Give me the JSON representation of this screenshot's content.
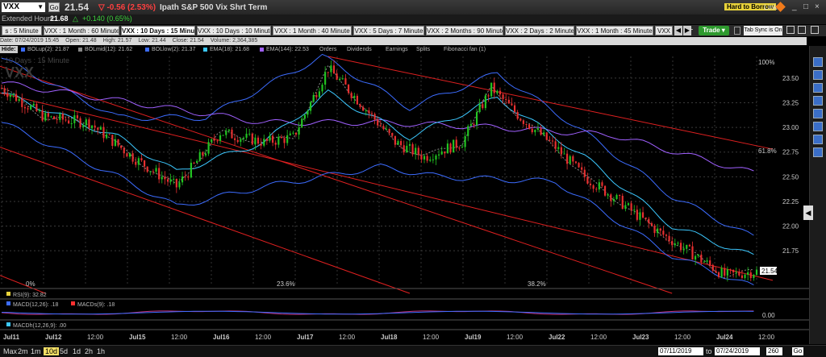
{
  "header": {
    "symbol": "VXX",
    "go_label": "Go",
    "last_price": "21.54",
    "change": "-0.56 (2.53%)",
    "name": "Ipath S&P 500 Vix Shrt Term",
    "hard_to_borrow": "Hard to Borrow",
    "link_label": "Link",
    "extended_label": "Extended Hours:",
    "extended_price": "21.68",
    "extended_change": "+0.140 (0.65%)"
  },
  "tabs": [
    "s : 5 Minute",
    "VXX : 1 Month : 60 Minute",
    "VXX : 10 Days : 15 Minute",
    "VXX : 10 Days : 10 Minute",
    "VXX : 1 Month : 40 Minute",
    "VXX : 5 Days : 7 Minute",
    "VXX : 2 Months : 90 Minute",
    "VXX : 2 Days : 2 Minute",
    "VXX : 1 Month : 45 Minute",
    "VXX"
  ],
  "trade_label": "Trade",
  "tab_sync_label": "Tab Sync is On",
  "info": {
    "date": "Date: 07/24/2019 15:45",
    "open": "Open: 21.48",
    "high": "High: 21.57",
    "low": "Low: 21.44",
    "close": "Close: 21.54",
    "volume": "Volume: 2,364,385"
  },
  "hide_label": "Hide:",
  "studies": [
    {
      "label": "BOLup(2): 21.87",
      "color": "#3c6cff"
    },
    {
      "label": "BOLmid(12): 21.62",
      "color": "#888888"
    },
    {
      "label": "BOLlow(2): 21.37",
      "color": "#3c6cff"
    },
    {
      "label": "EMA(18): 21.68",
      "color": "#3cc8ff"
    },
    {
      "label": "EMA(144): 22.53",
      "color": "#a060ff"
    },
    {
      "label": "Orders",
      "color": ""
    },
    {
      "label": "Dividends",
      "color": ""
    },
    {
      "label": "Earnings",
      "color": ""
    },
    {
      "label": "Splits",
      "color": ""
    },
    {
      "label": "Fibonacci fan (1)",
      "color": ""
    }
  ],
  "watermark": {
    "period": "10 Days : 15 Minute",
    "symbol": "VXX"
  },
  "lower_panes": [
    {
      "label": "RSI(9): 32.82",
      "color": "#e8d23a"
    },
    {
      "label": "MACD(12,26): .18",
      "label2": "MACDs(9): .18",
      "color": "#3c6cff",
      "color2": "#ff3030"
    },
    {
      "label": "MACDh(12,26,9): .00",
      "color": "#3cc8ff"
    }
  ],
  "macd_value": "0.00",
  "periods": [
    "Max",
    "2m",
    "1m",
    "10d",
    "5d",
    "1d",
    "2h",
    "1h"
  ],
  "active_period": "10d",
  "date_from": "07/11/2019",
  "date_to": "07/24/2019",
  "to_label": "to",
  "bars_value": "260",
  "bottom_go": "Go",
  "chart_data": {
    "type": "candlestick",
    "ylim": [
      21.4,
      23.72
    ],
    "y_ticks": [
      21.75,
      22.0,
      22.25,
      22.5,
      22.75,
      23.0,
      23.25,
      23.5
    ],
    "x_tick_labels": [
      "Jul11",
      "Jul12",
      "12:00",
      "Jul15",
      "12:00",
      "Jul16",
      "12:00",
      "Jul17",
      "12:00",
      "Jul18",
      "12:00",
      "Jul19",
      "12:00",
      "Jul22",
      "12:00",
      "Jul23",
      "12:00",
      "Jul24",
      "12:00"
    ],
    "trend_points": [
      [
        0,
        23.4
      ],
      [
        15,
        23.1
      ],
      [
        30,
        23.05
      ],
      [
        45,
        22.7
      ],
      [
        60,
        22.4
      ],
      [
        75,
        22.95
      ],
      [
        90,
        22.85
      ],
      [
        100,
        22.9
      ],
      [
        112,
        23.6
      ],
      [
        120,
        23.35
      ],
      [
        135,
        22.85
      ],
      [
        145,
        22.7
      ],
      [
        158,
        22.85
      ],
      [
        168,
        23.4
      ],
      [
        178,
        23.1
      ],
      [
        190,
        22.8
      ],
      [
        200,
        22.5
      ],
      [
        212,
        22.25
      ],
      [
        225,
        21.95
      ],
      [
        238,
        21.7
      ],
      [
        248,
        21.5
      ],
      [
        259,
        21.54
      ]
    ],
    "bollinger_up_points": [
      [
        0,
        23.7
      ],
      [
        40,
        23.1
      ],
      [
        70,
        23.1
      ],
      [
        110,
        23.72
      ],
      [
        140,
        23.2
      ],
      [
        170,
        23.55
      ],
      [
        200,
        22.95
      ],
      [
        230,
        22.3
      ],
      [
        259,
        21.87
      ]
    ],
    "bollinger_low_points": [
      [
        0,
        23.05
      ],
      [
        40,
        22.5
      ],
      [
        60,
        22.2
      ],
      [
        90,
        22.4
      ],
      [
        130,
        22.6
      ],
      [
        150,
        22.5
      ],
      [
        190,
        22.45
      ],
      [
        230,
        21.7
      ],
      [
        259,
        21.37
      ]
    ],
    "ema18_points": [
      [
        0,
        23.35
      ],
      [
        40,
        22.9
      ],
      [
        60,
        22.55
      ],
      [
        90,
        22.85
      ],
      [
        112,
        23.35
      ],
      [
        140,
        22.9
      ],
      [
        170,
        23.3
      ],
      [
        200,
        22.7
      ],
      [
        230,
        22.0
      ],
      [
        259,
        21.68
      ]
    ],
    "ema144_points": [
      [
        0,
        23.45
      ],
      [
        90,
        23.05
      ],
      [
        130,
        23.05
      ],
      [
        170,
        23.0
      ],
      [
        210,
        22.92
      ],
      [
        259,
        22.53
      ]
    ],
    "fib_labels": [
      "0%",
      "23.6%",
      "38.2%",
      "61.8%",
      "100%"
    ],
    "last_price_label": "21.54",
    "series": [
      {
        "name": "BOLup(2)",
        "color": "#3c6cff"
      },
      {
        "name": "BOLmid(12)",
        "color": "#888888"
      },
      {
        "name": "BOLlow(2)",
        "color": "#3c6cff"
      },
      {
        "name": "EMA(18)",
        "color": "#3cc8ff"
      },
      {
        "name": "EMA(144)",
        "color": "#a060ff"
      }
    ],
    "up_color": "#22c522",
    "down_color": "#e83030",
    "fib_color": "#e02020"
  }
}
